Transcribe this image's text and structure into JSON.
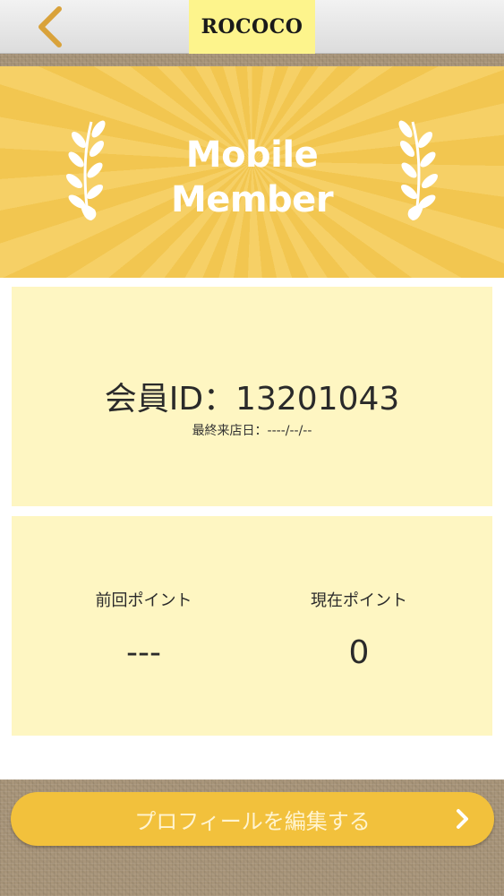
{
  "header": {
    "logo_text": "ROCOCO",
    "back_icon": "chevron-left-icon"
  },
  "banner": {
    "title_line1": "Mobile",
    "title_line2": "Member",
    "decoration_icon": "laurel-icon"
  },
  "member": {
    "id_text": "会員ID：13201043",
    "last_visit": "最終来店日：----/--/--"
  },
  "points": {
    "previous_label": "前回ポイント",
    "previous_value": "---",
    "current_label": "現在ポイント",
    "current_value": "0"
  },
  "footer": {
    "edit_profile_label": "プロフィールを編集する",
    "arrow_icon": "chevron-right-icon"
  },
  "colors": {
    "accent": "#f2c13c",
    "card_bg": "#fef6c2",
    "logo_bg": "#fdf48c"
  }
}
